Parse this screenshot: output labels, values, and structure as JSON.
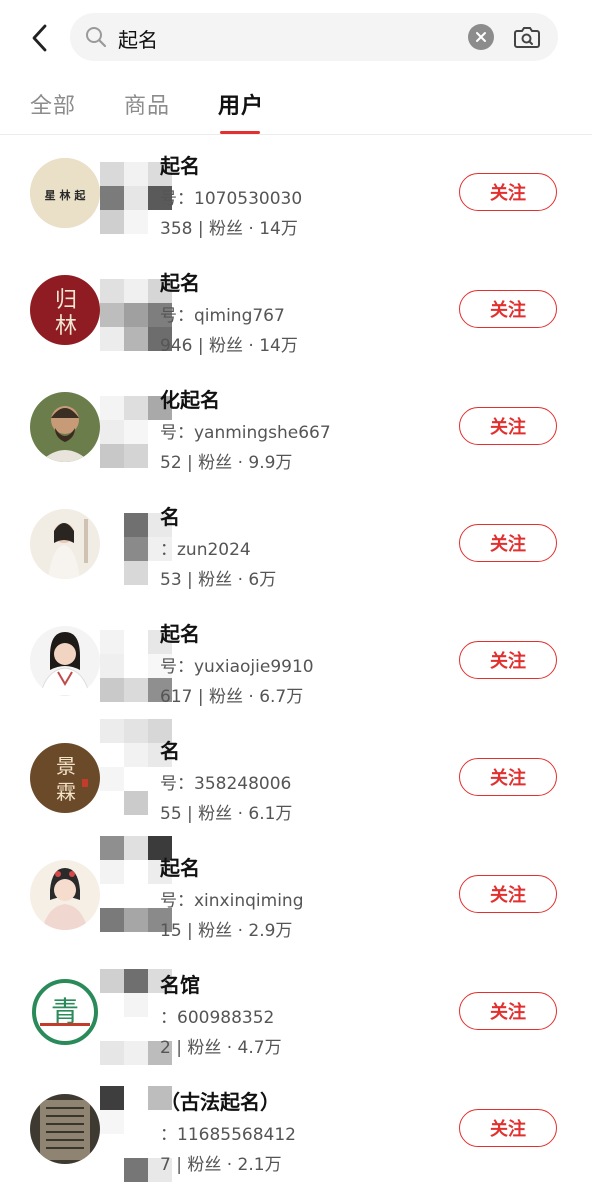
{
  "search": {
    "query": "起名",
    "placeholder": "",
    "back_icon": "back-arrow-icon",
    "search_icon": "search-icon",
    "clear_icon": "clear-icon",
    "camera_icon": "camera-search-icon"
  },
  "tabs": [
    {
      "label": "全部"
    },
    {
      "label": "商品"
    },
    {
      "label": "用户"
    }
  ],
  "active_tab": "用户",
  "colors": {
    "accent": "#e2302f",
    "text_primary": "#111111",
    "text_secondary": "#555555",
    "tab_inactive": "#8c8c8c"
  },
  "follow_label": "关注",
  "users": [
    {
      "name": "起名",
      "account": "号：1070530030",
      "stats": "358 | 粉丝 · 14万"
    },
    {
      "name": "起名",
      "account": "号：qiming767",
      "stats": "946 | 粉丝 · 14万"
    },
    {
      "name": "化起名",
      "account": "号：yanmingshe667",
      "stats": "52 | 粉丝 · 9.9万"
    },
    {
      "name": "名",
      "account": "：zun2024",
      "stats": "53 | 粉丝 · 6万"
    },
    {
      "name": "起名",
      "account": "号：yuxiaojie9910",
      "stats": "617 | 粉丝 · 6.7万"
    },
    {
      "name": "名",
      "account": "号：358248006",
      "stats": "55 | 粉丝 · 6.1万"
    },
    {
      "name": "起名",
      "account": "号：xinxinqiming",
      "stats": "15 | 粉丝 · 2.9万"
    },
    {
      "name": "名馆",
      "account": "：600988352",
      "stats": "2 | 粉丝 · 4.7万"
    },
    {
      "name": "（古法起名）",
      "account": "：11685568412",
      "stats": "7 | 粉丝 · 2.1万"
    }
  ]
}
